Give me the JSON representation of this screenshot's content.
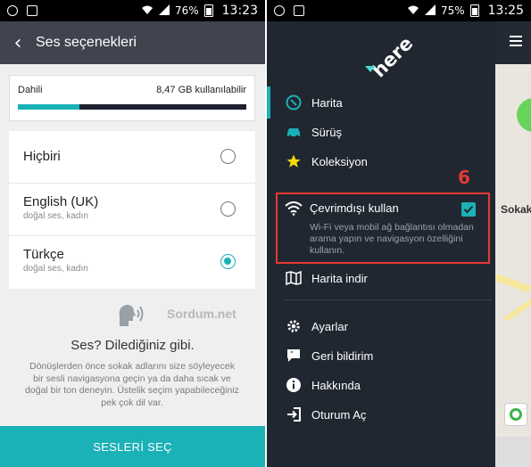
{
  "left": {
    "status": {
      "battery": "76%",
      "time": "13:23"
    },
    "header": {
      "title": "Ses seçenekleri",
      "back_icon": "back-arrow-icon"
    },
    "storage": {
      "label": "Dahili",
      "available": "8,47 GB kullanılabilir",
      "used_fraction": 0.27
    },
    "voices": [
      {
        "name": "Hiçbiri",
        "sub": "",
        "selected": false
      },
      {
        "name": "English (UK)",
        "sub": "doğal ses, kadın",
        "selected": false
      },
      {
        "name": "Türkçe",
        "sub": "doğal ses, kadın",
        "selected": true
      }
    ],
    "watermark": "Sordum.net",
    "pitch_title": "Ses? Dilediğiniz gibi.",
    "pitch_desc": "Dönüşlerden önce sokak adlarını size söyleyecek bir sesli navigasyona geçin ya da daha sıcak ve doğal bir ton deneyin. Üstelik seçim yapabileceğiniz pek çok dil var.",
    "cta": "SESLERİ SEÇ",
    "colors": {
      "accent": "#1ab1b7",
      "header": "#40444f"
    }
  },
  "right": {
    "status": {
      "battery": "75%",
      "time": "13:25"
    },
    "logo": "here",
    "menu_top": [
      {
        "label": "Harita",
        "icon": "compass-icon"
      },
      {
        "label": "Sürüş",
        "icon": "car-icon"
      },
      {
        "label": "Koleksiyon",
        "icon": "star-icon"
      }
    ],
    "offline": {
      "label": "Çevrimdışı kullan",
      "checked": true,
      "desc": "Wi-Fi veya mobil ağ bağlantısı olmadan arama yapın ve navigasyon özelliğini kullanın."
    },
    "annotation": "6",
    "menu_mid": [
      {
        "label": "Harita indir",
        "icon": "map-download-icon"
      }
    ],
    "menu_bottom": [
      {
        "label": "Ayarlar",
        "icon": "gear-icon"
      },
      {
        "label": "Geri bildirim",
        "icon": "feedback-icon"
      },
      {
        "label": "Hakkında",
        "icon": "info-icon"
      },
      {
        "label": "Oturum Aç",
        "icon": "sign-in-icon"
      }
    ],
    "map_label": "Sokak",
    "colors": {
      "highlight": "#e53935",
      "menu_bg": "#202731"
    }
  }
}
